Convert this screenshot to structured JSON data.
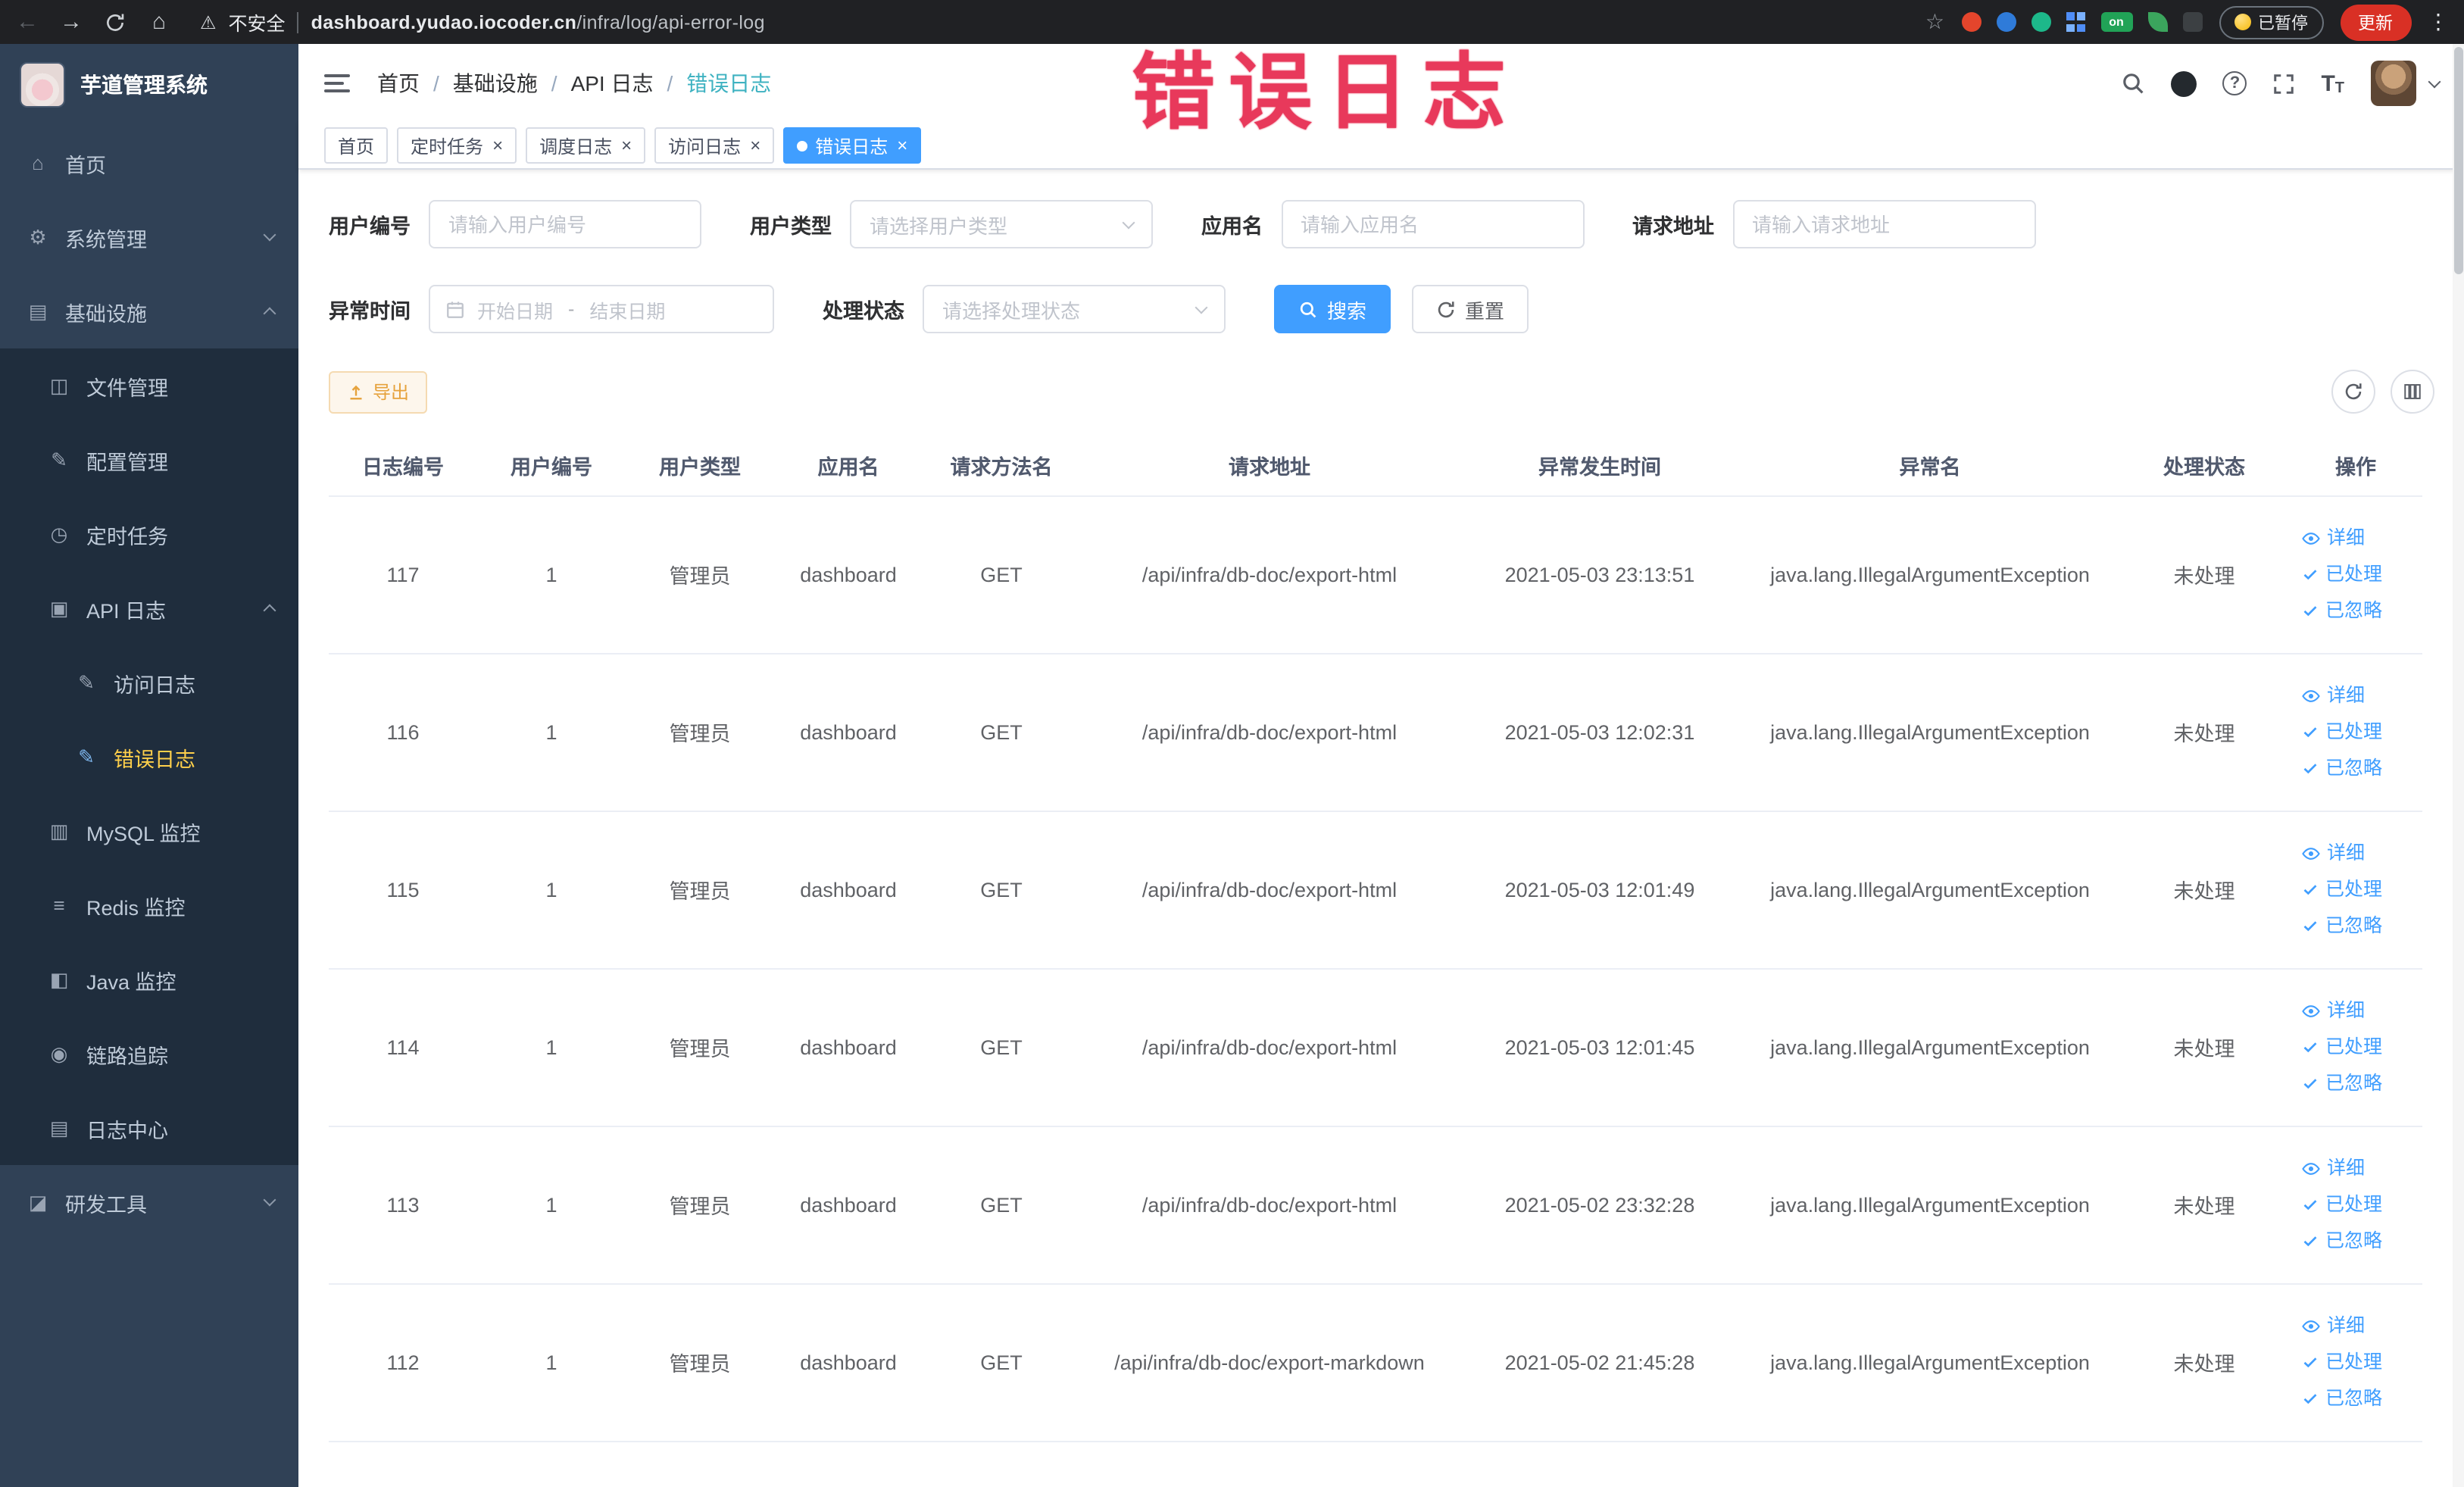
{
  "glyphs": {
    "back": "←",
    "forward": "→",
    "home": "⌂",
    "warning": "⚠",
    "star": "☆",
    "more": "⋮",
    "close": "×",
    "question": "?",
    "font_big": "T",
    "font_small": "T"
  },
  "browser": {
    "security_label": "不安全",
    "url_domain": "dashboard.yudao.iocoder.cn",
    "url_path": "/infra/log/api-error-log",
    "paused_badge": "已暂停",
    "update_button": "更新",
    "extensions": [
      {
        "name": "adblock-extension-icon",
        "class": "ext-red"
      },
      {
        "name": "drop-extension-icon",
        "class": "ext-blue"
      },
      {
        "name": "green-extension-icon",
        "class": "ext-teal"
      },
      {
        "name": "grid-extension-icon",
        "class": "ext-grid"
      },
      {
        "name": "on-badge-extension-icon",
        "class": "ext-on",
        "label": "on"
      },
      {
        "name": "leaf-extension-icon",
        "class": "ext-leaf"
      },
      {
        "name": "puzzle-extension-icon",
        "class": "ext-puzzle"
      }
    ]
  },
  "sidebar": {
    "logo_title": "芋道管理系统",
    "items": [
      {
        "label": "首页",
        "icon": "home-icon",
        "glyph": "⌂",
        "depth": 0
      },
      {
        "label": "系统管理",
        "icon": "gear-icon",
        "glyph": "⚙",
        "depth": 0,
        "arrow": "down"
      },
      {
        "label": "基础设施",
        "icon": "infrastructure-icon",
        "glyph": "▤",
        "depth": 0,
        "arrow": "up"
      },
      {
        "label": "文件管理",
        "icon": "file-management-icon",
        "glyph": "◫",
        "depth": 1,
        "sub": true
      },
      {
        "label": "配置管理",
        "icon": "config-management-icon",
        "glyph": "✎",
        "depth": 1,
        "sub": true
      },
      {
        "label": "定时任务",
        "icon": "scheduled-task-icon",
        "glyph": "◷",
        "depth": 1,
        "sub": true
      },
      {
        "label": "API 日志",
        "icon": "api-log-icon",
        "glyph": "▣",
        "depth": 1,
        "sub": true,
        "arrow": "up"
      },
      {
        "label": "访问日志",
        "icon": "access-log-icon",
        "glyph": "✎",
        "depth": 2,
        "sub": true
      },
      {
        "label": "错误日志",
        "icon": "error-log-icon",
        "glyph": "✎",
        "depth": 2,
        "sub": true,
        "active": true
      },
      {
        "label": "MySQL 监控",
        "icon": "mysql-monitor-icon",
        "glyph": "▥",
        "depth": 1,
        "sub": true
      },
      {
        "label": "Redis 监控",
        "icon": "redis-monitor-icon",
        "glyph": "≡",
        "depth": 1,
        "sub": true
      },
      {
        "label": "Java 监控",
        "icon": "java-monitor-icon",
        "glyph": "◧",
        "depth": 1,
        "sub": true
      },
      {
        "label": "链路追踪",
        "icon": "trace-icon",
        "glyph": "◉",
        "depth": 1,
        "sub": true
      },
      {
        "label": "日志中心",
        "icon": "log-center-icon",
        "glyph": "▤",
        "depth": 1,
        "sub": true
      },
      {
        "label": "研发工具",
        "icon": "dev-tools-icon",
        "glyph": "◪",
        "depth": 0,
        "arrow": "down"
      }
    ]
  },
  "header": {
    "breadcrumbs": [
      "首页",
      "基础设施",
      "API 日志",
      "错误日志"
    ],
    "breadcrumb_separator": "/",
    "annotation": "错误日志"
  },
  "tabs": [
    {
      "label": "首页",
      "closable": false,
      "active": false
    },
    {
      "label": "定时任务",
      "closable": true,
      "active": false
    },
    {
      "label": "调度日志",
      "closable": true,
      "active": false
    },
    {
      "label": "访问日志",
      "closable": true,
      "active": false
    },
    {
      "label": "错误日志",
      "closable": true,
      "active": true
    }
  ],
  "filters": {
    "user_id": {
      "label": "用户编号",
      "placeholder": "请输入用户编号"
    },
    "user_type": {
      "label": "用户类型",
      "placeholder": "请选择用户类型"
    },
    "app_name": {
      "label": "应用名",
      "placeholder": "请输入应用名"
    },
    "request_url": {
      "label": "请求地址",
      "placeholder": "请输入请求地址"
    },
    "exception_time": {
      "label": "异常时间",
      "start_placeholder": "开始日期",
      "separator": "-",
      "end_placeholder": "结束日期"
    },
    "process_status": {
      "label": "处理状态",
      "placeholder": "请选择处理状态"
    },
    "search_button": "搜索",
    "reset_button": "重置"
  },
  "toolbar": {
    "export_button": "导出"
  },
  "table": {
    "columns": [
      "日志编号",
      "用户编号",
      "用户类型",
      "应用名",
      "请求方法名",
      "请求地址",
      "异常发生时间",
      "异常名",
      "处理状态",
      "操作"
    ],
    "action_labels": {
      "detail": "详细",
      "processed": "已处理",
      "ignored": "已忽略"
    },
    "rows": [
      {
        "id": "117",
        "user_id": "1",
        "user_type": "管理员",
        "app": "dashboard",
        "method": "GET",
        "url": "/api/infra/db-doc/export-html",
        "time": "2021-05-03 23:13:51",
        "exception": "java.lang.IllegalArgumentException",
        "status": "未处理"
      },
      {
        "id": "116",
        "user_id": "1",
        "user_type": "管理员",
        "app": "dashboard",
        "method": "GET",
        "url": "/api/infra/db-doc/export-html",
        "time": "2021-05-03 12:02:31",
        "exception": "java.lang.IllegalArgumentException",
        "status": "未处理"
      },
      {
        "id": "115",
        "user_id": "1",
        "user_type": "管理员",
        "app": "dashboard",
        "method": "GET",
        "url": "/api/infra/db-doc/export-html",
        "time": "2021-05-03 12:01:49",
        "exception": "java.lang.IllegalArgumentException",
        "status": "未处理"
      },
      {
        "id": "114",
        "user_id": "1",
        "user_type": "管理员",
        "app": "dashboard",
        "method": "GET",
        "url": "/api/infra/db-doc/export-html",
        "time": "2021-05-03 12:01:45",
        "exception": "java.lang.IllegalArgumentException",
        "status": "未处理"
      },
      {
        "id": "113",
        "user_id": "1",
        "user_type": "管理员",
        "app": "dashboard",
        "method": "GET",
        "url": "/api/infra/db-doc/export-html",
        "time": "2021-05-02 23:32:28",
        "exception": "java.lang.IllegalArgumentException",
        "status": "未处理"
      },
      {
        "id": "112",
        "user_id": "1",
        "user_type": "管理员",
        "app": "dashboard",
        "method": "GET",
        "url": "/api/infra/db-doc/export-markdown",
        "time": "2021-05-02 21:45:28",
        "exception": "java.lang.IllegalArgumentException",
        "status": "未处理"
      }
    ]
  }
}
